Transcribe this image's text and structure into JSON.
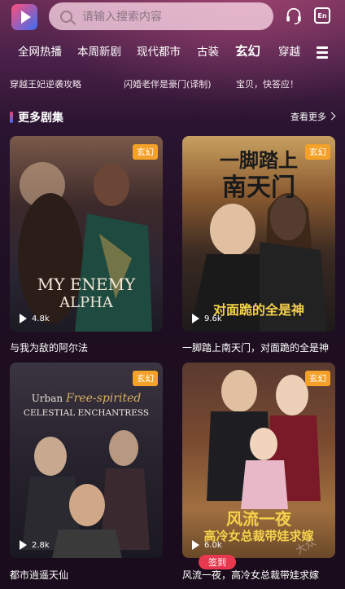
{
  "header": {
    "logo_icon": "play-logo-icon",
    "search_placeholder": "请输入搜索内容",
    "support_icon": "headset-icon",
    "lang_icon": "en-language-icon",
    "lang_label": "En"
  },
  "tabs": [
    "全网热播",
    "本周新剧",
    "现代都市",
    "古装",
    "玄幻",
    "穿越"
  ],
  "active_tab": "玄幻",
  "marquee": [
    "穿越王妃逆袭攻略",
    "闪婚老伴是豪门(译制)",
    "宝贝，快答应！"
  ],
  "section": {
    "title": "更多剧集",
    "see_more": "查看更多"
  },
  "cards": [
    {
      "tag": "玄幻",
      "views": "4.8k",
      "title": "与我为敌的阿尔法",
      "poster_line1": "MY ENEMY",
      "poster_line2": "ALPHA"
    },
    {
      "tag": "玄幻",
      "views": "9.6k",
      "title": "一脚踏上南天门，对面跪的全是神",
      "poster_line1": "一脚踏上",
      "poster_line2": "南天门",
      "poster_line3": "对面跪的全是神"
    },
    {
      "tag": "玄幻",
      "views": "2.8k",
      "title": "都市逍遥天仙",
      "poster_line1": "Urban",
      "poster_line2": "Free-spirited",
      "poster_line3": "CELESTIAL ENCHANTRESS"
    },
    {
      "tag": "玄幻",
      "views": "6.0k",
      "title": "风流一夜，高冷女总裁带娃求嫁",
      "poster_line1": "风流一夜",
      "poster_line2": "高冷女总裁带娃求嫁"
    }
  ],
  "sign_button": "签到",
  "watermark": "大众"
}
